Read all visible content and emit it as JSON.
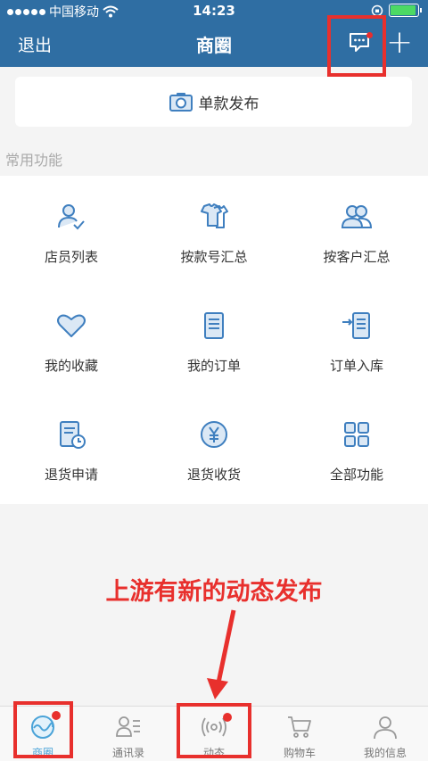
{
  "status_bar": {
    "carrier": "中国移动",
    "time": "14:23"
  },
  "nav": {
    "exit": "退出",
    "title": "商圈"
  },
  "publish": {
    "label": "单款发布"
  },
  "section": {
    "title": "常用功能"
  },
  "functions": [
    {
      "label": "店员列表",
      "icon": "staff-icon"
    },
    {
      "label": "按款号汇总",
      "icon": "clothes-icon"
    },
    {
      "label": "按客户汇总",
      "icon": "customers-icon"
    },
    {
      "label": "我的收藏",
      "icon": "heart-icon"
    },
    {
      "label": "我的订单",
      "icon": "order-icon"
    },
    {
      "label": "订单入库",
      "icon": "stock-in-icon"
    },
    {
      "label": "退货申请",
      "icon": "return-request-icon"
    },
    {
      "label": "退货收货",
      "icon": "yen-icon"
    },
    {
      "label": "全部功能",
      "icon": "grid-icon"
    }
  ],
  "annotation": {
    "text": "上游有新的动态发布"
  },
  "tabs": [
    {
      "label": "商圈",
      "icon": "business-circle-icon",
      "active": true,
      "badge": true
    },
    {
      "label": "通讯录",
      "icon": "contacts-icon",
      "active": false,
      "badge": false
    },
    {
      "label": "动态",
      "icon": "broadcast-icon",
      "active": false,
      "badge": true
    },
    {
      "label": "购物车",
      "icon": "cart-icon",
      "active": false,
      "badge": false
    },
    {
      "label": "我的信息",
      "icon": "profile-icon",
      "active": false,
      "badge": false
    }
  ],
  "colors": {
    "primary": "#2f6ea3",
    "icon_blue": "#3f7fbf",
    "highlight_red": "#e8302d",
    "active_tab": "#4aa3d8"
  }
}
